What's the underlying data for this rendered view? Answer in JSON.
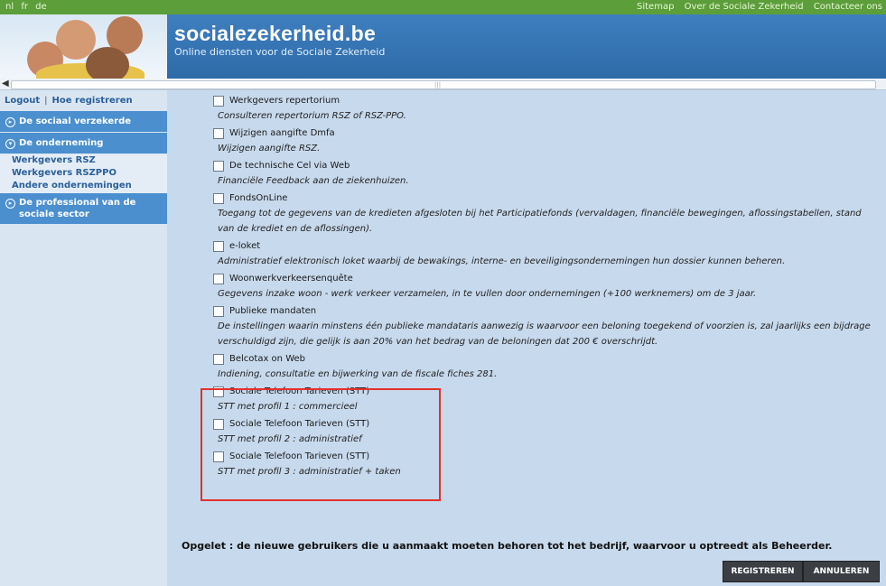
{
  "topbar": {
    "languages": [
      "nl",
      "fr",
      "de"
    ],
    "links": [
      "Sitemap",
      "Over de Sociale Zekerheid",
      "Contacteer ons"
    ]
  },
  "header": {
    "site_name": "socialezekerheid.be",
    "tagline": "Online diensten voor de Sociale Zekerheid"
  },
  "sidebar": {
    "logout": "Logout",
    "separator": "|",
    "register": "Hoe registreren",
    "sections": [
      {
        "label": "De sociaal verzekerde"
      },
      {
        "label": "De onderneming"
      },
      {
        "label": "De professional van de sociale sector"
      }
    ],
    "subitems": [
      "Werkgevers RSZ",
      "Werkgevers RSZPPO",
      "Andere ondernemingen"
    ]
  },
  "services": [
    {
      "title": "Werkgevers repertorium",
      "desc": "Consulteren repertorium RSZ of RSZ-PPO."
    },
    {
      "title": "Wijzigen aangifte Dmfa",
      "desc": "Wijzigen aangifte RSZ."
    },
    {
      "title": "De technische Cel via Web",
      "desc": "Financiële Feedback aan de ziekenhuizen."
    },
    {
      "title": "FondsOnLine",
      "desc": "Toegang tot de gegevens van de kredieten afgesloten bij het Participatiefonds (vervaldagen, financiële bewegingen, aflossingstabellen, stand van de krediet en de aflossingen)."
    },
    {
      "title": "e-loket",
      "desc": "Administratief elektronisch loket waarbij de bewakings, interne- en beveiligingsondernemingen hun dossier kunnen beheren."
    },
    {
      "title": "Woonwerkverkeersenquête",
      "desc": "Gegevens inzake woon - werk verkeer verzamelen, in te vullen door ondernemingen (+100 werknemers) om de 3 jaar."
    },
    {
      "title": "Publieke mandaten",
      "desc": "De instellingen waarin minstens één publieke mandataris aanwezig is waarvoor een beloning toegekend of voorzien is, zal jaarlijks een bijdrage verschuldigd zijn, die gelijk is aan 20% van het bedrag van de beloningen dat 200 € overschrijdt."
    },
    {
      "title": "Belcotax on Web",
      "desc": "Indiening, consultatie en bijwerking van de fiscale fiches 281."
    },
    {
      "title": "Sociale Telefoon Tarieven (STT)",
      "desc": "STT met profil 1 : commercieel"
    },
    {
      "title": "Sociale Telefoon Tarieven (STT)",
      "desc": "STT met profil 2 : administratief"
    },
    {
      "title": "Sociale Telefoon Tarieven (STT)",
      "desc": "STT met profil 3 : administratief + taken"
    }
  ],
  "note": "Opgelet : de nieuwe gebruikers die u aanmaakt moeten behoren tot het bedrijf, waarvoor u optreedt als Beheerder.",
  "buttons": {
    "register": "REGISTREREN",
    "cancel": "ANNULEREN"
  },
  "colors": {
    "topbar": "#5c9e3a",
    "header": "#3f7fbf",
    "sidebar_section": "#4b8fcf",
    "main_bg": "#c7d9ec",
    "highlight": "#e5302b"
  }
}
